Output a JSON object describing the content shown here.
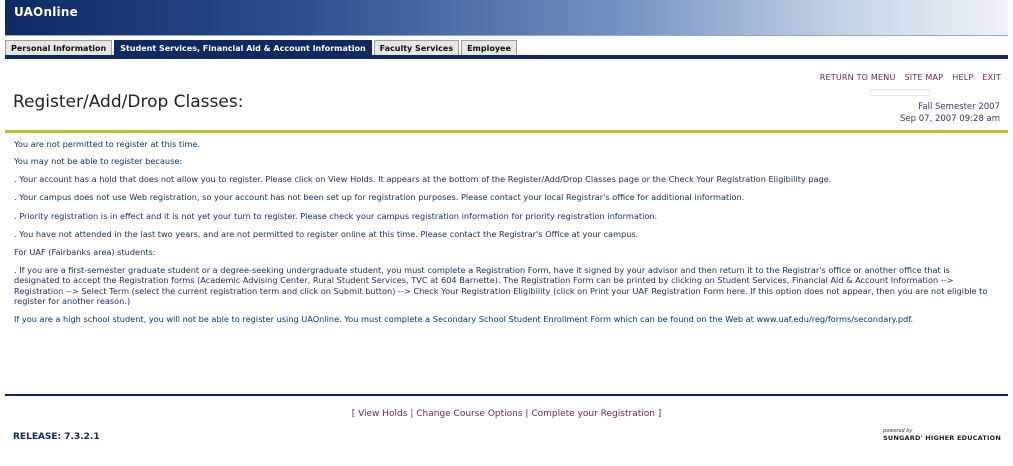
{
  "header": {
    "logo": "UAOnline"
  },
  "tabs": [
    {
      "label": "Personal Information"
    },
    {
      "label": "Student Services, Financial Aid & Account Information"
    },
    {
      "label": "Faculty Services"
    },
    {
      "label": "Employee"
    }
  ],
  "nav": {
    "return_to_menu": "RETURN TO MENU",
    "site_map": "SITE MAP",
    "help": "HELP",
    "exit": "EXIT"
  },
  "page": {
    "title": "Register/Add/Drop Classes:",
    "term": "Fall Semester 2007",
    "datetime": "Sep 07, 2007 09:28 am"
  },
  "messages": [
    "You are not permitted to register at this time.",
    "You may not be able to register because:",
    ". Your account has a hold that does not allow you to register. Please click on View Holds. It appears at the bottom of the Register/Add/Drop Classes page or the Check Your Registration Eligibility page.",
    ". Your campus does not use Web registration, so your account has not been set up for registration purposes. Please contact your local Registrar's office for additional information.",
    ". Priority registration is in effect and it is not yet your turn to register. Please check your campus registration information for priority registration information.",
    ". You have not attended in the last two years, and are not permitted to register online at this time. Please contact the Registrar's Office at your campus.",
    "For UAF (Fairbanks area) students:",
    ". If you are a first-semester graduate student or a degree-seeking undergraduate student, you must complete a Registration Form, have it signed by your advisor and then return it to the Registrar's office or another office that is designated to accept the Registration forms (Academic Advising Center, Rural Student Services, TVC at 604 Barnette). The Registration Form can be printed by clicking on Student Services, Financial Aid & Account Information --> Registration --> Select Term (select the current registration term and click on Submit button) --> Check Your Registration Eligibility (click on Print your UAF Registration Form here. If this option does not appear, then you are not eligible to register for another reason.)",
    "If you are a high school student, you will not be able to register using UAOnline. You must complete a Secondary School Student Enrollment Form which can be found on the Web at www.uaf.edu/reg/forms/secondary.pdf."
  ],
  "footer_links": {
    "view_holds": "View Holds",
    "change_course_options": "Change Course Options",
    "complete_registration": "Complete your Registration"
  },
  "release": "RELEASE: 7.3.2.1",
  "powered": {
    "small": "powered by",
    "brand": "SUNGARD' HIGHER EDUCATION"
  },
  "colors": {
    "navy": "#0f2a63",
    "gold": "#c9bd2e",
    "link_maroon": "#7a1f4a",
    "body_text": "#18306a"
  }
}
